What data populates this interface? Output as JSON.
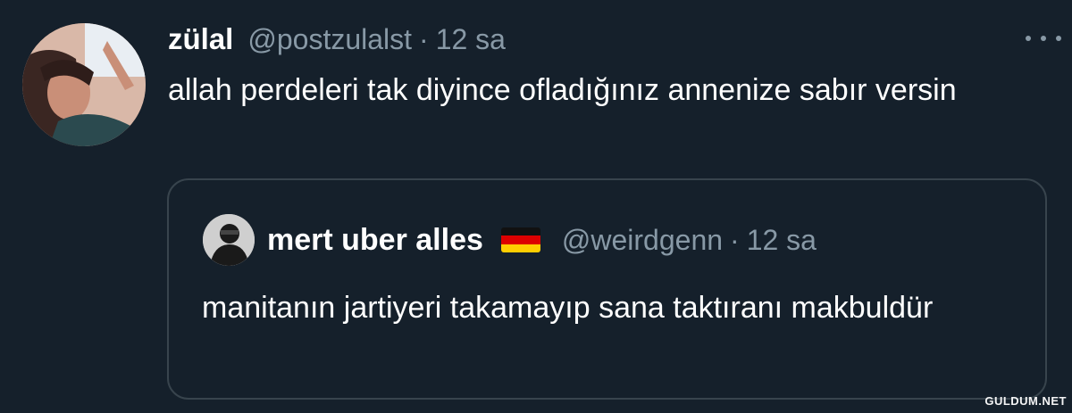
{
  "tweet": {
    "display_name": "zülal",
    "handle": "@postzulalst",
    "separator": "·",
    "time": "12 sa",
    "text": "allah perdeleri tak diyince ofladığınız annenize sabır versin",
    "more_icon": "more-horizontal-icon"
  },
  "quoted": {
    "display_name": "mert uber alles",
    "flag_emoji_icon": "germany-flag-icon",
    "handle": "@weirdgenn",
    "separator": "·",
    "time": "12 sa",
    "text": "manitanın jartiyeri takamayıp sana taktıranı makbuldür"
  },
  "watermark": "GULDUM.NET",
  "colors": {
    "background": "#15202b",
    "secondary_text": "#8899a6",
    "border": "#38444d"
  }
}
